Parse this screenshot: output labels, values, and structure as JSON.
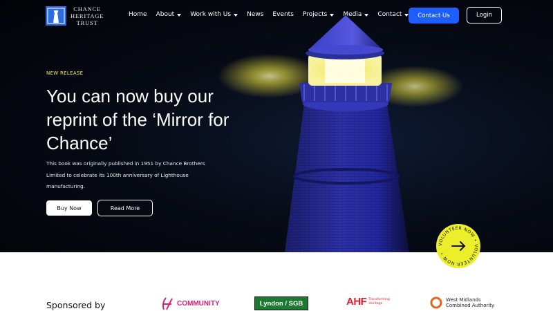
{
  "brand": {
    "logo_lines": [
      "CHANCE",
      "HERITAGE",
      "TRUST"
    ]
  },
  "nav": {
    "items": [
      {
        "label": "Home",
        "dropdown": false
      },
      {
        "label": "About",
        "dropdown": true
      },
      {
        "label": "Work with Us",
        "dropdown": true
      },
      {
        "label": "News",
        "dropdown": false
      },
      {
        "label": "Events",
        "dropdown": false
      },
      {
        "label": "Projects",
        "dropdown": true
      },
      {
        "label": "Media",
        "dropdown": true
      },
      {
        "label": "Contact",
        "dropdown": true
      }
    ],
    "contact_button": "Contact Us",
    "login_button": "Login"
  },
  "hero": {
    "eyebrow": "NEW RELEASE",
    "title": "You can now buy our reprint of the ‘Mirror for Chance’",
    "description": "This book was originally published in 1951 by Chance Brothers Limited to celebrate its 100th anniversary of Lighthouse manufacturing.",
    "buy_button": "Buy Now",
    "read_button": "Read More",
    "volunteer_badge": "VOLUNTEER NOW • VOLUNTEER NOW •"
  },
  "sponsors": {
    "heading": "Sponsored by",
    "community": "COMMUNITY",
    "lyndon": "Lyndon / SGB",
    "ahf_main": "AHF",
    "ahf_sub": "Transforming Heritage",
    "wm_line1": "West Midlands",
    "wm_line2": "Combined Authority"
  },
  "colors": {
    "accent_blue": "#1d5eff",
    "eyebrow_yellow": "#f4e64a",
    "badge_yellow": "#ecee2a",
    "community_pink": "#d6217a",
    "lyndon_green": "#1a7a2f",
    "ahf_red": "#e31d2b"
  }
}
